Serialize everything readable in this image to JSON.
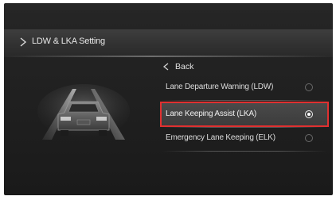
{
  "header": {
    "title": "LDW & LKA Setting"
  },
  "back": {
    "label": "Back"
  },
  "options": [
    {
      "label": "Lane Departure Warning (LDW)",
      "selected": false
    },
    {
      "label": "Lane Keeping Assist (LKA)",
      "selected": true
    },
    {
      "label": "Emergency Lane Keeping (ELK)",
      "selected": false
    }
  ],
  "colors": {
    "selection_outline": "#e03030",
    "background": "#222222",
    "text": "#dcdcdc"
  },
  "icons": {
    "header": "chevron-right-icon",
    "back": "chevron-left-icon",
    "illustration": "car-rear-icon"
  }
}
